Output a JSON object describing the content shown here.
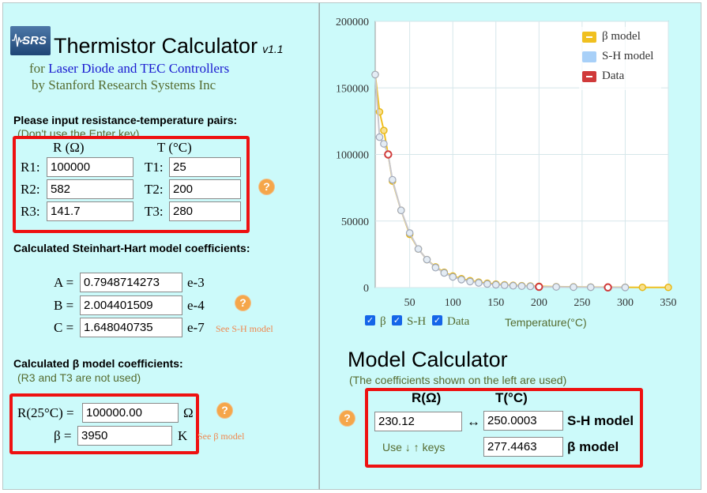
{
  "header": {
    "logo_text": "SRS",
    "title": "Thermistor Calculator",
    "version": "v1.1",
    "subtitle_for": "for",
    "subtitle_link": "Laser Diode and TEC Controllers",
    "subtitle_by": "by Stanford Research Systems Inc"
  },
  "input_section": {
    "heading": "Please input resistance-temperature pairs:",
    "note": "(Don't use the Enter key)",
    "col_r": "R (Ω)",
    "col_t": "T (°C)",
    "rows": [
      {
        "r_label": "R1:",
        "r_value": "100000",
        "t_label": "T1:",
        "t_value": "25"
      },
      {
        "r_label": "R2:",
        "r_value": "582",
        "t_label": "T2:",
        "t_value": "200"
      },
      {
        "r_label": "R3:",
        "r_value": "141.7",
        "t_label": "T3:",
        "t_value": "280"
      }
    ],
    "help_symbol": "?"
  },
  "sh_section": {
    "heading": "Calculated Steinhart-Hart model coefficients:",
    "rows": [
      {
        "label": "A =",
        "value": "0.7948714273",
        "exp": "e-3"
      },
      {
        "label": "B =",
        "value": "2.004401509",
        "exp": "e-4"
      },
      {
        "label": "C =",
        "value": "1.648040735",
        "exp": "e-7"
      }
    ],
    "see_link": "See S-H model",
    "help_symbol": "?"
  },
  "beta_section": {
    "heading": "Calculated β model coefficients:",
    "note": "(R3 and T3 are not used)",
    "r25_label": "R(25°C) =",
    "r25_value": "100000.00",
    "r25_unit": "Ω",
    "beta_label": "β =",
    "beta_value": "3950",
    "beta_unit": "K",
    "see_link": "See β model",
    "help_symbol": "?"
  },
  "chart_data": {
    "type": "line",
    "xlabel": "Temperature(°C)",
    "ylabel": "",
    "xlim": [
      10,
      350
    ],
    "ylim": [
      0,
      200000
    ],
    "x_ticks": [
      50,
      100,
      150,
      200,
      250,
      300,
      350
    ],
    "y_ticks": [
      0,
      50000,
      100000,
      150000,
      200000
    ],
    "grid": true,
    "legend_position": "top-right",
    "series": [
      {
        "name": "β model",
        "color": "#f0c020",
        "x": [
          10,
          15,
          20,
          25,
          30,
          40,
          50,
          60,
          70,
          80,
          90,
          100,
          110,
          120,
          130,
          140,
          150,
          160,
          170,
          180,
          190,
          200,
          220,
          240,
          260,
          280,
          300,
          320,
          350
        ],
        "y": [
          160000,
          132000,
          118000,
          100000,
          80000,
          58000,
          40000,
          29000,
          21000,
          15500,
          11500,
          8700,
          6700,
          5200,
          4100,
          3300,
          2600,
          2100,
          1700,
          1400,
          1200,
          1000,
          700,
          520,
          390,
          300,
          230,
          180,
          130
        ]
      },
      {
        "name": "S-H model",
        "color": "#a8d0f8",
        "x": [
          10,
          15,
          20,
          25,
          30,
          40,
          50,
          60,
          70,
          80,
          90,
          100,
          110,
          120,
          130,
          140,
          150,
          160,
          170,
          180,
          190,
          200,
          220,
          240,
          260,
          280,
          300
        ],
        "y": [
          160000,
          113000,
          108000,
          100000,
          81000,
          58000,
          41000,
          29000,
          21000,
          15000,
          11000,
          8000,
          6000,
          4500,
          3500,
          2700,
          2100,
          1700,
          1350,
          1100,
          900,
          582,
          500,
          350,
          250,
          141.7,
          100
        ]
      },
      {
        "name": "Data",
        "color": "#d03a3a",
        "x": [
          25,
          200,
          280
        ],
        "y": [
          100000,
          582,
          141.7
        ]
      }
    ]
  },
  "chart_controls": {
    "cb_beta": "β",
    "cb_sh": "S-H",
    "cb_data": "Data",
    "check_glyph": "✓"
  },
  "model_calc": {
    "title": "Model Calculator",
    "note": "(The coefficients shown on the left are used)",
    "col_r": "R(Ω)",
    "col_t": "T(°C)",
    "r_value": "230.12",
    "arrow": "↔",
    "sh_t_value": "250.0003",
    "sh_label": "S-H model",
    "hint": "Use ↓ ↑ keys",
    "beta_t_value": "277.4463",
    "beta_label": "β model",
    "help_symbol": "?"
  }
}
